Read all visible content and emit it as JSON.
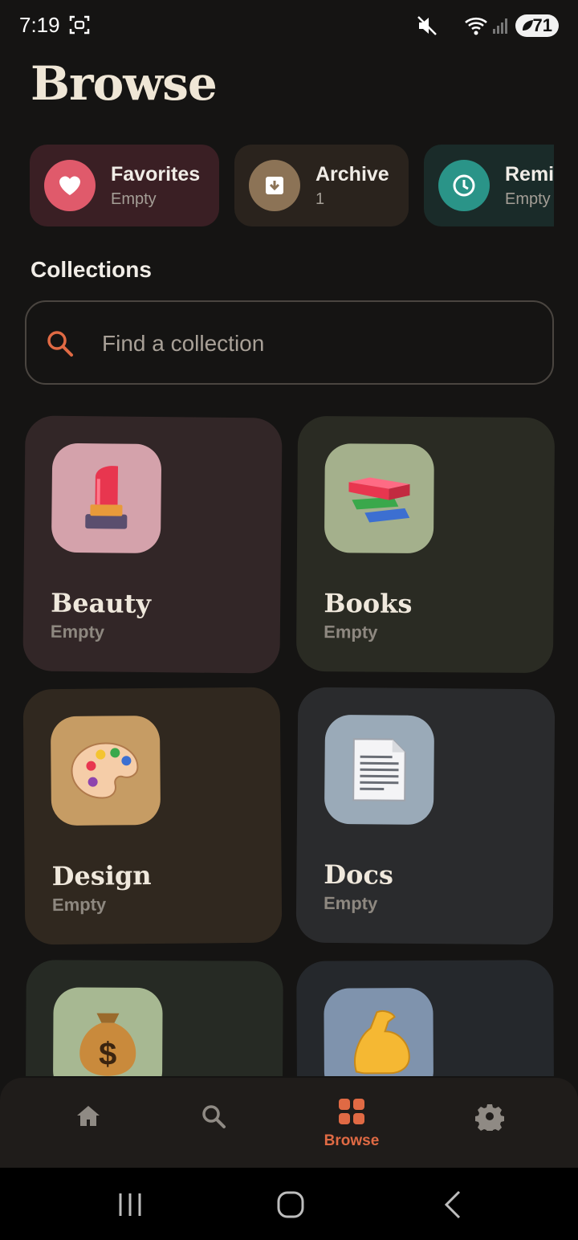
{
  "status_bar": {
    "time": "7:19",
    "battery": "71",
    "icons": [
      "screenshot-icon",
      "mute-icon",
      "wifi-icon",
      "signal-icon",
      "battery-saver-icon"
    ]
  },
  "page": {
    "title": "Browse"
  },
  "quick_access": [
    {
      "label": "Favorites",
      "sub": "Empty",
      "icon": "heart-icon",
      "color": "#e05a6b",
      "bg": "#3a1f24"
    },
    {
      "label": "Archive",
      "sub": "1",
      "icon": "archive-icon",
      "color": "#8c7356",
      "bg": "#2a231d"
    },
    {
      "label": "Reminders",
      "sub": "Empty",
      "icon": "clock-icon",
      "color": "#2a9488",
      "bg": "#1a2b29"
    }
  ],
  "collections": {
    "heading": "Collections",
    "search_placeholder": "Find a collection",
    "items": [
      {
        "name": "Beauty",
        "sub": "Empty",
        "icon": "lipstick-icon",
        "emoji": "💄",
        "bg": "#322627",
        "icon_bg": "#d4a2ab"
      },
      {
        "name": "Books",
        "sub": "Empty",
        "icon": "books-icon",
        "emoji": "📚",
        "bg": "#2a2b23",
        "icon_bg": "#a4b08c"
      },
      {
        "name": "Design",
        "sub": "Empty",
        "icon": "palette-icon",
        "emoji": "🎨",
        "bg": "#30281f",
        "icon_bg": "#c69c64"
      },
      {
        "name": "Docs",
        "sub": "Empty",
        "icon": "document-icon",
        "emoji": "📄",
        "bg": "#2a2b2d",
        "icon_bg": "#9aaab8"
      },
      {
        "name": "",
        "sub": "",
        "icon": "money-bag-icon",
        "emoji": "💰",
        "bg": "#262a24",
        "icon_bg": "#a7b892"
      },
      {
        "name": "",
        "sub": "",
        "icon": "flexed-biceps-icon",
        "emoji": "💪",
        "bg": "#25282c",
        "icon_bg": "#7f93ad"
      }
    ]
  },
  "bottom_nav": {
    "items": [
      {
        "label": "",
        "icon": "home-icon"
      },
      {
        "label": "",
        "icon": "search-icon"
      },
      {
        "label": "Browse",
        "icon": "grid-icon",
        "active": true
      },
      {
        "label": "",
        "icon": "settings-icon"
      }
    ],
    "active_color": "#e06a44",
    "inactive_color": "#8f8a84"
  },
  "system_nav": [
    "recents-button",
    "home-button",
    "back-button"
  ]
}
